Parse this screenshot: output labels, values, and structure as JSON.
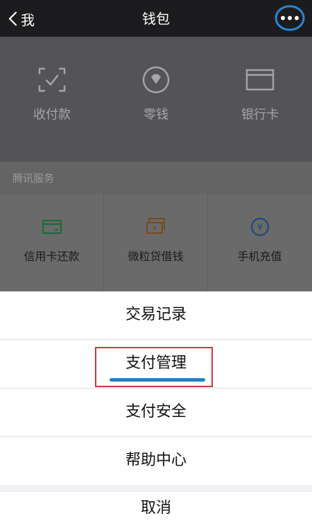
{
  "nav": {
    "back_label": "我",
    "title": "钱包"
  },
  "wallet": {
    "items": [
      {
        "label": "收付款"
      },
      {
        "label": "零钱"
      },
      {
        "label": "银行卡"
      }
    ]
  },
  "services": {
    "section_title": "腾讯服务",
    "items": [
      {
        "label": "信用卡还款"
      },
      {
        "label": "微粒贷借钱"
      },
      {
        "label": "手机充值"
      }
    ]
  },
  "sheet": {
    "items": [
      {
        "label": "交易记录"
      },
      {
        "label": "支付管理"
      },
      {
        "label": "支付安全"
      },
      {
        "label": "帮助中心"
      }
    ],
    "cancel_label": "取消"
  },
  "colors": {
    "highlight_box": "#d0343b",
    "underline": "#1f7fc8",
    "annotation_circle": "#2a86d9"
  }
}
